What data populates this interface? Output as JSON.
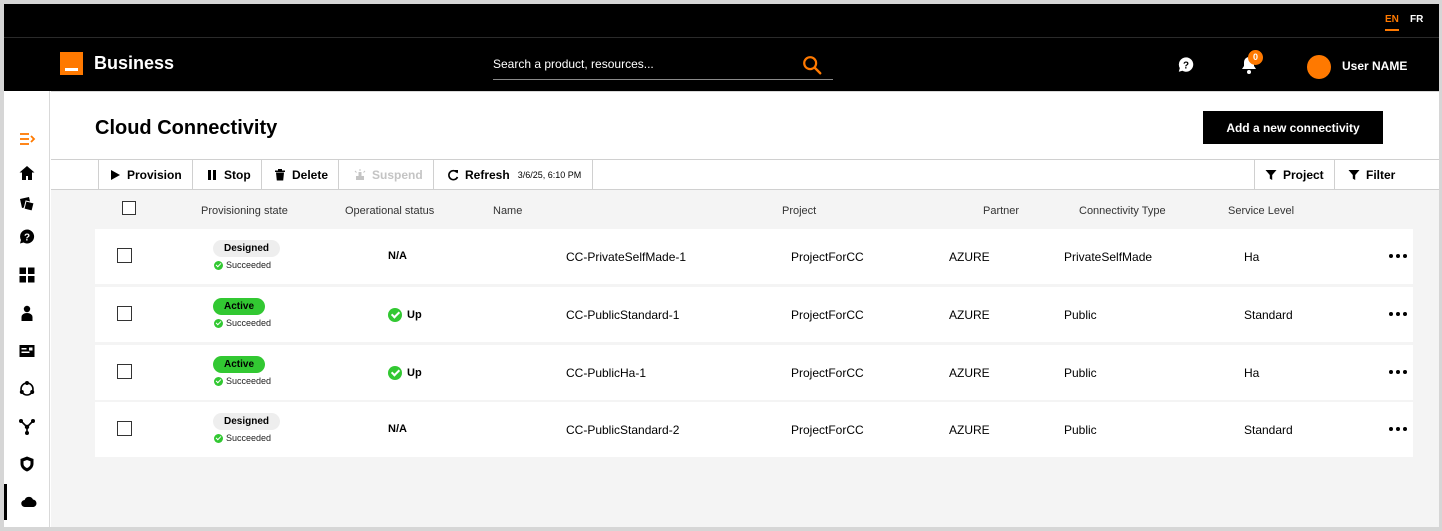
{
  "languages": {
    "en": "EN",
    "fr": "FR"
  },
  "header": {
    "brand": "Business",
    "search_placeholder": "Search a product, resources...",
    "notifications_count": "0",
    "user_name": "User NAME"
  },
  "sidebar": {
    "items": [
      {
        "icon": "menu-expand-icon"
      },
      {
        "icon": "home-icon"
      },
      {
        "icon": "tickets-icon"
      },
      {
        "icon": "help-icon"
      },
      {
        "icon": "dashboard-icon"
      },
      {
        "icon": "user-icon"
      },
      {
        "icon": "id-card-icon"
      },
      {
        "icon": "network-icon"
      },
      {
        "icon": "topology-icon"
      },
      {
        "icon": "shield-icon"
      },
      {
        "icon": "cloud-icon"
      }
    ]
  },
  "page": {
    "title": "Cloud Connectivity",
    "add_button": "Add a new connectivity"
  },
  "toolbar": {
    "provision": "Provision",
    "stop": "Stop",
    "delete": "Delete",
    "suspend": "Suspend",
    "refresh": "Refresh",
    "refresh_timestamp": "3/6/25, 6:10 PM",
    "project": "Project",
    "filter": "Filter"
  },
  "table": {
    "columns": {
      "provisioning_state": "Provisioning state",
      "operational_status": "Operational status",
      "name": "Name",
      "project": "Project",
      "partner": "Partner",
      "connectivity_type": "Connectivity Type",
      "service_level": "Service Level"
    },
    "rows": [
      {
        "state": "Designed",
        "state_kind": "designed",
        "sub_state": "Succeeded",
        "op_status": "N/A",
        "op_ok": false,
        "name": "CC-PrivateSelfMade-1",
        "project": "ProjectForCC",
        "partner": "AZURE",
        "type": "PrivateSelfMade",
        "service_level": "Ha"
      },
      {
        "state": "Active",
        "state_kind": "active",
        "sub_state": "Succeeded",
        "op_status": "Up",
        "op_ok": true,
        "name": "CC-PublicStandard-1",
        "project": "ProjectForCC",
        "partner": "AZURE",
        "type": "Public",
        "service_level": "Standard"
      },
      {
        "state": "Active",
        "state_kind": "active",
        "sub_state": "Succeeded",
        "op_status": "Up",
        "op_ok": true,
        "name": "CC-PublicHa-1",
        "project": "ProjectForCC",
        "partner": "AZURE",
        "type": "Public",
        "service_level": "Ha"
      },
      {
        "state": "Designed",
        "state_kind": "designed",
        "sub_state": "Succeeded",
        "op_status": "N/A",
        "op_ok": false,
        "name": "CC-PublicStandard-2",
        "project": "ProjectForCC",
        "partner": "AZURE",
        "type": "Public",
        "service_level": "Standard"
      }
    ]
  },
  "colors": {
    "accent": "#ff7900",
    "active": "#32c832",
    "header_bg": "#000000",
    "content_bg": "#f4f4f4"
  }
}
